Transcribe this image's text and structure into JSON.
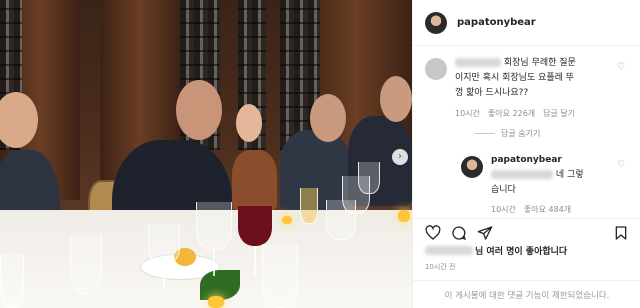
{
  "post": {
    "username": "papatonybear"
  },
  "comments": [
    {
      "text_line1": "회장님 무례한 질문",
      "text_line2": "이지만 혹시 회장님도 요플레 뚜",
      "text_line3": "껑 핥아 드시나요??",
      "time": "10시간",
      "likes": "좋아요 226개",
      "reply_label": "답글 달기"
    }
  ],
  "hide_replies_label": "답글 숨기기",
  "reply": {
    "username": "papatonybear",
    "text_after_mention": "네 그렇",
    "text_line2": "습니다",
    "time": "10시간",
    "likes": "좋아요 484개"
  },
  "likes_summary": {
    "suffix": "님 여러 명이 좋아합니다"
  },
  "post_time": "10시간 전",
  "footer_notice": "이 게시물에 대한 댓글 기능이 제한되었습니다.",
  "icons": {
    "like": "heart-icon",
    "comment": "comment-icon",
    "share": "send-icon",
    "save": "bookmark-icon",
    "carousel": "chevron-right-icon"
  },
  "colors": {
    "text": "#262626",
    "secondary": "#8e8e8e",
    "border": "#efefef"
  }
}
